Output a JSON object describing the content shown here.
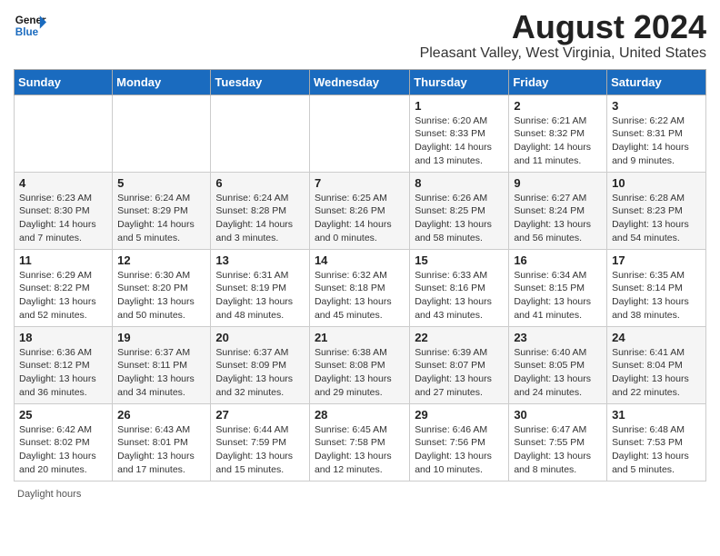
{
  "logo": {
    "line1": "General",
    "line2": "Blue"
  },
  "title": "August 2024",
  "location": "Pleasant Valley, West Virginia, United States",
  "days_of_week": [
    "Sunday",
    "Monday",
    "Tuesday",
    "Wednesday",
    "Thursday",
    "Friday",
    "Saturday"
  ],
  "weeks": [
    [
      {
        "day": "",
        "info": ""
      },
      {
        "day": "",
        "info": ""
      },
      {
        "day": "",
        "info": ""
      },
      {
        "day": "",
        "info": ""
      },
      {
        "day": "1",
        "info": "Sunrise: 6:20 AM\nSunset: 8:33 PM\nDaylight: 14 hours\nand 13 minutes."
      },
      {
        "day": "2",
        "info": "Sunrise: 6:21 AM\nSunset: 8:32 PM\nDaylight: 14 hours\nand 11 minutes."
      },
      {
        "day": "3",
        "info": "Sunrise: 6:22 AM\nSunset: 8:31 PM\nDaylight: 14 hours\nand 9 minutes."
      }
    ],
    [
      {
        "day": "4",
        "info": "Sunrise: 6:23 AM\nSunset: 8:30 PM\nDaylight: 14 hours\nand 7 minutes."
      },
      {
        "day": "5",
        "info": "Sunrise: 6:24 AM\nSunset: 8:29 PM\nDaylight: 14 hours\nand 5 minutes."
      },
      {
        "day": "6",
        "info": "Sunrise: 6:24 AM\nSunset: 8:28 PM\nDaylight: 14 hours\nand 3 minutes."
      },
      {
        "day": "7",
        "info": "Sunrise: 6:25 AM\nSunset: 8:26 PM\nDaylight: 14 hours\nand 0 minutes."
      },
      {
        "day": "8",
        "info": "Sunrise: 6:26 AM\nSunset: 8:25 PM\nDaylight: 13 hours\nand 58 minutes."
      },
      {
        "day": "9",
        "info": "Sunrise: 6:27 AM\nSunset: 8:24 PM\nDaylight: 13 hours\nand 56 minutes."
      },
      {
        "day": "10",
        "info": "Sunrise: 6:28 AM\nSunset: 8:23 PM\nDaylight: 13 hours\nand 54 minutes."
      }
    ],
    [
      {
        "day": "11",
        "info": "Sunrise: 6:29 AM\nSunset: 8:22 PM\nDaylight: 13 hours\nand 52 minutes."
      },
      {
        "day": "12",
        "info": "Sunrise: 6:30 AM\nSunset: 8:20 PM\nDaylight: 13 hours\nand 50 minutes."
      },
      {
        "day": "13",
        "info": "Sunrise: 6:31 AM\nSunset: 8:19 PM\nDaylight: 13 hours\nand 48 minutes."
      },
      {
        "day": "14",
        "info": "Sunrise: 6:32 AM\nSunset: 8:18 PM\nDaylight: 13 hours\nand 45 minutes."
      },
      {
        "day": "15",
        "info": "Sunrise: 6:33 AM\nSunset: 8:16 PM\nDaylight: 13 hours\nand 43 minutes."
      },
      {
        "day": "16",
        "info": "Sunrise: 6:34 AM\nSunset: 8:15 PM\nDaylight: 13 hours\nand 41 minutes."
      },
      {
        "day": "17",
        "info": "Sunrise: 6:35 AM\nSunset: 8:14 PM\nDaylight: 13 hours\nand 38 minutes."
      }
    ],
    [
      {
        "day": "18",
        "info": "Sunrise: 6:36 AM\nSunset: 8:12 PM\nDaylight: 13 hours\nand 36 minutes."
      },
      {
        "day": "19",
        "info": "Sunrise: 6:37 AM\nSunset: 8:11 PM\nDaylight: 13 hours\nand 34 minutes."
      },
      {
        "day": "20",
        "info": "Sunrise: 6:37 AM\nSunset: 8:09 PM\nDaylight: 13 hours\nand 32 minutes."
      },
      {
        "day": "21",
        "info": "Sunrise: 6:38 AM\nSunset: 8:08 PM\nDaylight: 13 hours\nand 29 minutes."
      },
      {
        "day": "22",
        "info": "Sunrise: 6:39 AM\nSunset: 8:07 PM\nDaylight: 13 hours\nand 27 minutes."
      },
      {
        "day": "23",
        "info": "Sunrise: 6:40 AM\nSunset: 8:05 PM\nDaylight: 13 hours\nand 24 minutes."
      },
      {
        "day": "24",
        "info": "Sunrise: 6:41 AM\nSunset: 8:04 PM\nDaylight: 13 hours\nand 22 minutes."
      }
    ],
    [
      {
        "day": "25",
        "info": "Sunrise: 6:42 AM\nSunset: 8:02 PM\nDaylight: 13 hours\nand 20 minutes."
      },
      {
        "day": "26",
        "info": "Sunrise: 6:43 AM\nSunset: 8:01 PM\nDaylight: 13 hours\nand 17 minutes."
      },
      {
        "day": "27",
        "info": "Sunrise: 6:44 AM\nSunset: 7:59 PM\nDaylight: 13 hours\nand 15 minutes."
      },
      {
        "day": "28",
        "info": "Sunrise: 6:45 AM\nSunset: 7:58 PM\nDaylight: 13 hours\nand 12 minutes."
      },
      {
        "day": "29",
        "info": "Sunrise: 6:46 AM\nSunset: 7:56 PM\nDaylight: 13 hours\nand 10 minutes."
      },
      {
        "day": "30",
        "info": "Sunrise: 6:47 AM\nSunset: 7:55 PM\nDaylight: 13 hours\nand 8 minutes."
      },
      {
        "day": "31",
        "info": "Sunrise: 6:48 AM\nSunset: 7:53 PM\nDaylight: 13 hours\nand 5 minutes."
      }
    ]
  ],
  "footer": "Daylight hours"
}
